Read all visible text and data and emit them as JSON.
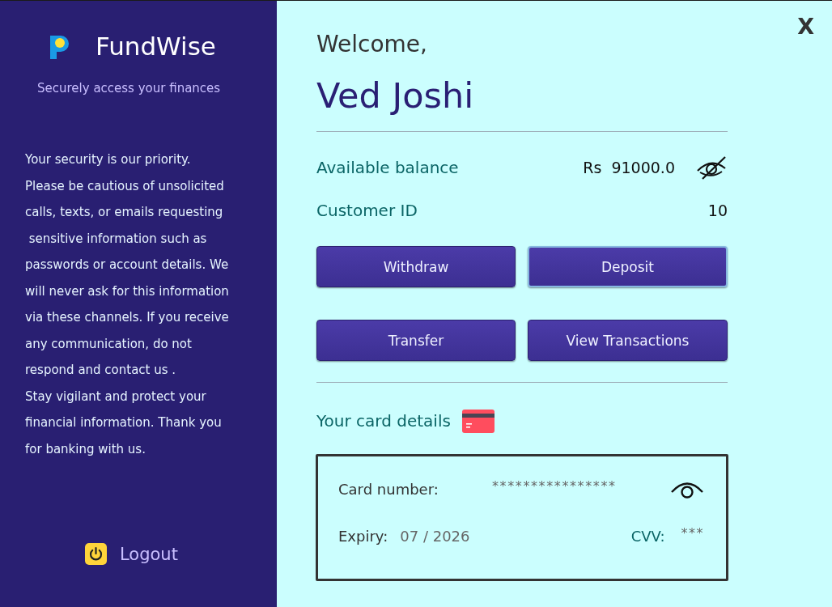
{
  "sidebar": {
    "brand": "FundWise",
    "tagline": "Securely access your finances",
    "notice_lines": [
      "Your security is our priority.",
      "Please be cautious of unsolicited",
      "calls, texts, or emails requesting",
      " sensitive information such as",
      "passwords or account details. We",
      "will never ask for this information",
      "via these channels. If you receive",
      "any communication, do not",
      "respond and contact us .",
      "Stay vigilant and protect your",
      "financial information. Thank you",
      "for banking with us."
    ],
    "logout": "Logout"
  },
  "close_button": "X",
  "greeting": "Welcome,",
  "user_name": "Ved Joshi",
  "balance": {
    "label": "Available balance",
    "currency": "Rs",
    "amount": "91000.0",
    "visible": true
  },
  "customer_id": {
    "label": "Customer ID",
    "value": "10"
  },
  "actions": [
    {
      "label": "Withdraw",
      "focused": false
    },
    {
      "label": "Deposit",
      "focused": true
    },
    {
      "label": "Transfer",
      "focused": false
    },
    {
      "label": "View Transactions",
      "focused": false
    }
  ],
  "card": {
    "heading": "Your card details",
    "number_label": "Card number:",
    "number": "****************",
    "number_visible": false,
    "expiry_label": "Expiry:",
    "expiry": "07 / 2026",
    "cvv_label": "CVV:",
    "cvv": "***"
  }
}
